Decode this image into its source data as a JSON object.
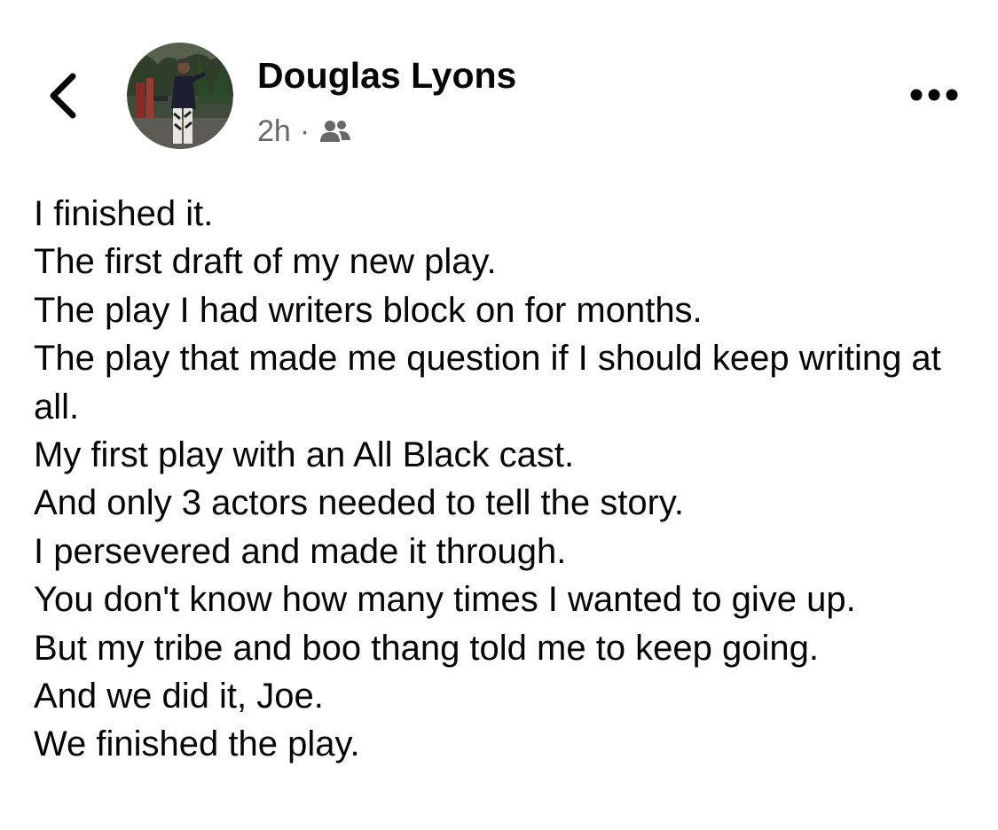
{
  "header": {
    "back_icon": "chevron-left-icon",
    "author_name": "Douglas Lyons",
    "timestamp": "2h",
    "separator": "·",
    "audience_icon": "friends-icon",
    "more_icon": "more-horizontal-icon"
  },
  "post": {
    "lines": [
      "I finished it.",
      "The first draft of my new play.",
      "The play I had writers block on for months.",
      "The play that made me question if I should keep writing at all.",
      "My first play with an All Black cast.",
      "And only 3 actors needed to tell the story.",
      "I persevered and made it through.",
      "You don't know how many times I wanted to give up.",
      "But my tribe and boo thang told me to keep going.",
      "And we did it, Joe.",
      "We finished the play."
    ]
  },
  "colors": {
    "text": "#050505",
    "secondary_text": "#65676b",
    "background": "#ffffff"
  }
}
